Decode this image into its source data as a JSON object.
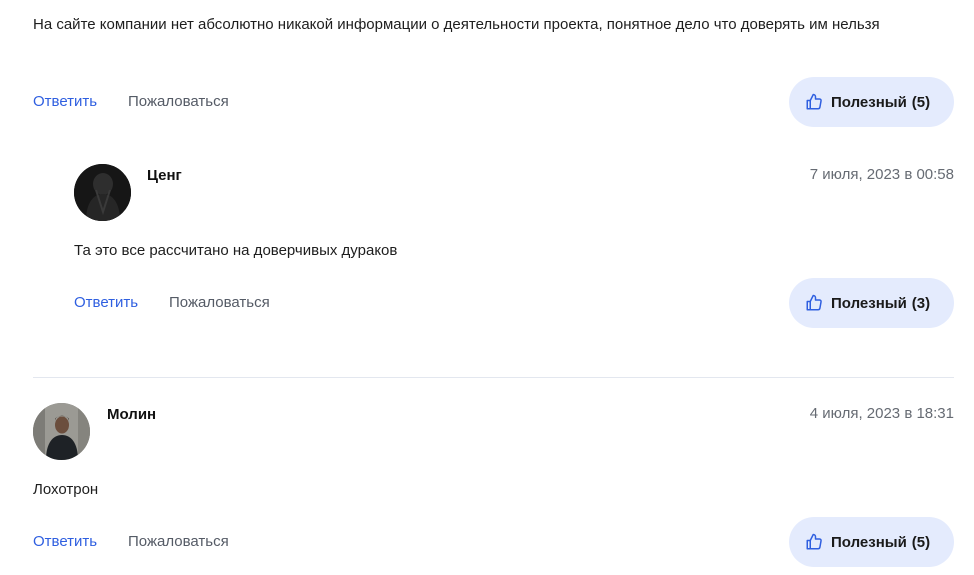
{
  "comment1": {
    "text": "На сайте компании нет абсолютно никакой информации о деятельности проекта, понятное дело что доверять им нельзя",
    "reply_label": "Ответить",
    "report_label": "Пожаловаться",
    "helpful_label": "Полезный",
    "helpful_count": "(5)"
  },
  "reply1": {
    "author": "Ценг",
    "date": "7 июля, 2023 в 00:58",
    "text": "Та это все рассчитано на доверчивых дураков",
    "reply_label": "Ответить",
    "report_label": "Пожаловаться",
    "helpful_label": "Полезный",
    "helpful_count": "(3)"
  },
  "comment2": {
    "author": "Молин",
    "date": "4 июля, 2023 в 18:31",
    "text": "Лохотрон",
    "reply_label": "Ответить",
    "report_label": "Пожаловаться",
    "helpful_label": "Полезный",
    "helpful_count": "(5)"
  },
  "colors": {
    "accent": "#2f5fe0",
    "button_bg": "#e4ebfd",
    "muted_text": "#555b66",
    "divider": "#e3e7ef"
  },
  "icons": {
    "helpful": "thumbs-up-icon"
  }
}
